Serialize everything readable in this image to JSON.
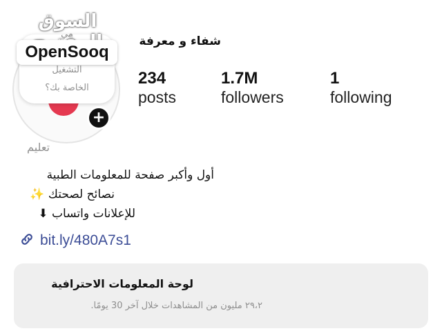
{
  "profile": {
    "name": "شفاء و معرفة",
    "category": "تعليم",
    "note_lines": [
      "مي",
      "التشغيل",
      "الخاصة بك؟"
    ],
    "add_icon": "+"
  },
  "watermark": {
    "arabic": "السوق المفتوح",
    "brand": "OpenSooq"
  },
  "stats": {
    "posts": {
      "value": "234",
      "label": "posts"
    },
    "followers": {
      "value": "1.7M",
      "label": "followers"
    },
    "following": {
      "value": "1",
      "label": "following"
    }
  },
  "bio": {
    "line1": "أول وأكبر صفحة للمعلومات الطبية",
    "line2": "نصائح لصحتك ✨",
    "line3": "للإعلانات واتساب ⬇"
  },
  "link": {
    "text": "bit.ly/480A7s1",
    "icon": "link-icon",
    "color": "#3c4d96"
  },
  "dashboard": {
    "title": "لوحة المعلومات الاحترافية",
    "subtitle": "٢٩،٢ مليون من المشاهدات خلال آخر 30 يومًا."
  },
  "colors": {
    "text": "#111111",
    "muted": "#8e8e8e",
    "card_bg": "#efefef",
    "avatar_accent": "#e53950"
  }
}
